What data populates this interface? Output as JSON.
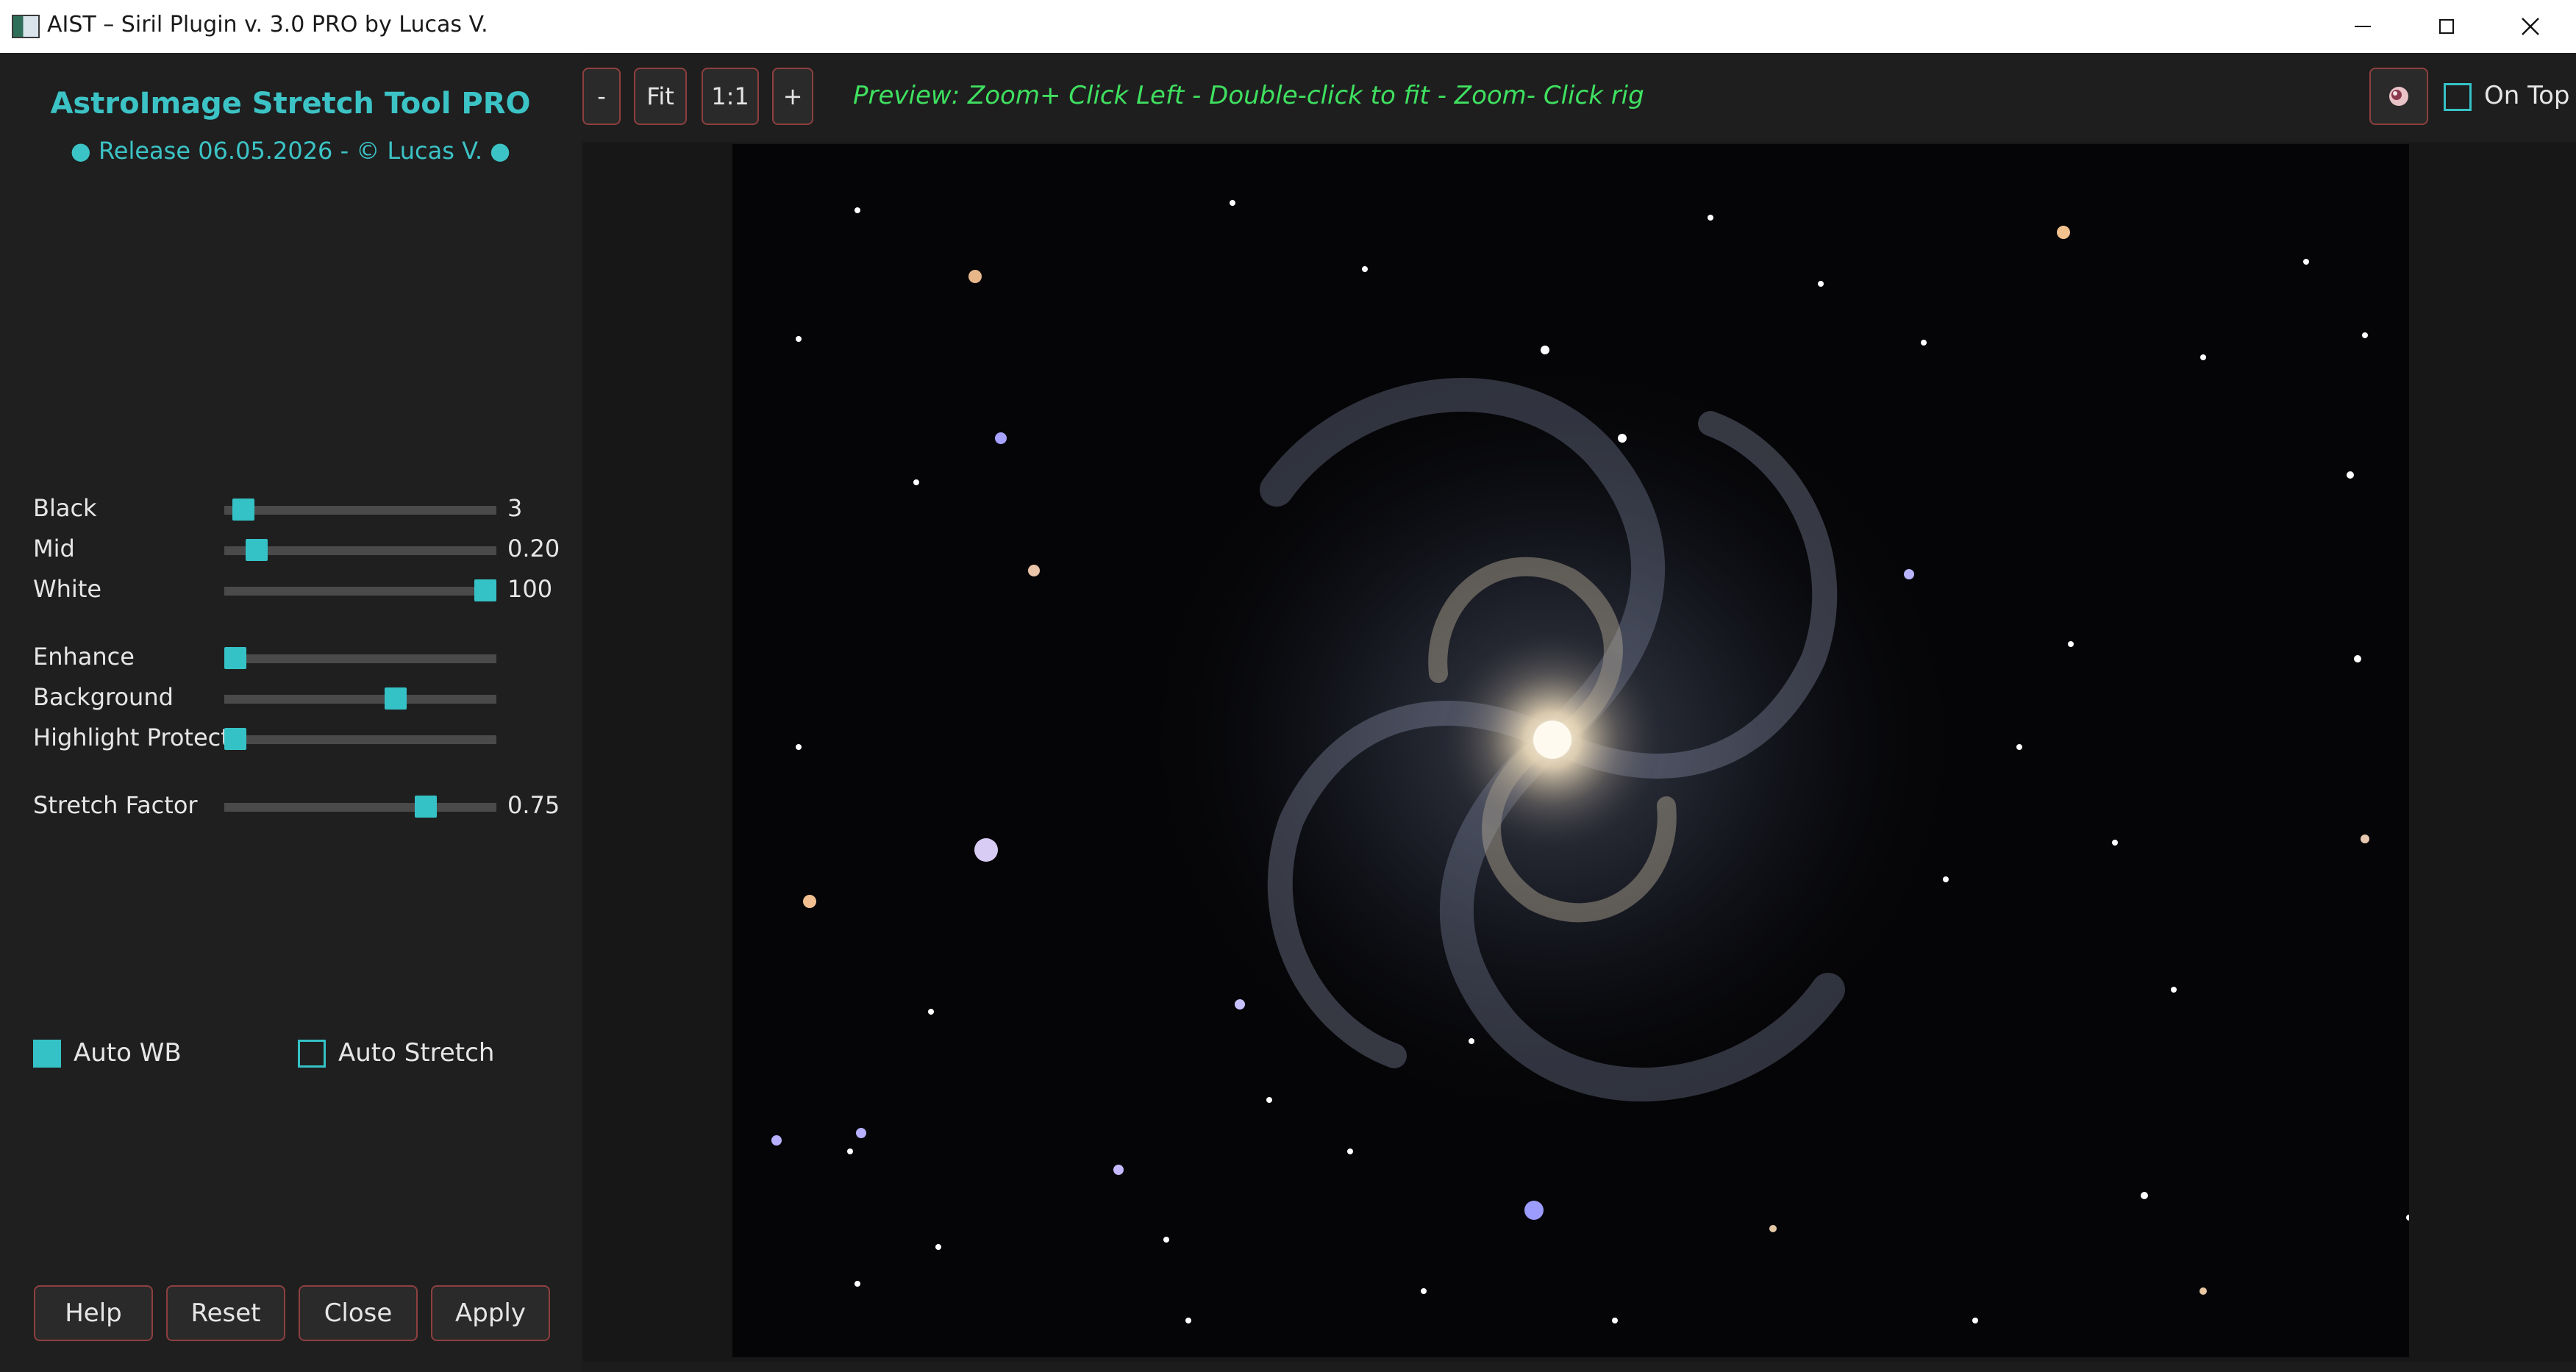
{
  "window": {
    "title": "AIST – Siril Plugin v. 3.0 PRO by Lucas V."
  },
  "sidebar": {
    "app_title": "AstroImage Stretch Tool PRO",
    "release_line": "● Release 06.05.2026 - © Lucas V. ●",
    "sliders": [
      {
        "label": "Black",
        "value_text": "3",
        "position": 0.07
      },
      {
        "label": "Mid",
        "value_text": "0.20",
        "position": 0.12
      },
      {
        "label": "White",
        "value_text": "100",
        "position": 0.96
      },
      {
        "label": "Enhance",
        "value_text": "",
        "position": 0.04
      },
      {
        "label": "Background",
        "value_text": "",
        "position": 0.63
      },
      {
        "label": "Highlight Protect",
        "value_text": "",
        "position": 0.04
      },
      {
        "label": "Stretch Factor",
        "value_text": "0.75",
        "position": 0.74
      }
    ],
    "checkboxes": [
      {
        "label": "Auto WB",
        "checked": true
      },
      {
        "label": "Auto Stretch",
        "checked": false
      }
    ],
    "buttons": [
      "Help",
      "Reset",
      "Close",
      "Apply"
    ]
  },
  "toolbar": {
    "zoom_out": "-",
    "fit": "Fit",
    "one_to_one": "1:1",
    "zoom_in": "+",
    "hint": "Preview: Zoom+ Click Left - Double-click to fit - Zoom- Click rig",
    "on_top_label": "On Top",
    "on_top_checked": false
  },
  "colors": {
    "accent": "#35c2c6",
    "hint_green": "#3fe060",
    "button_border": "#8e3f3f"
  }
}
